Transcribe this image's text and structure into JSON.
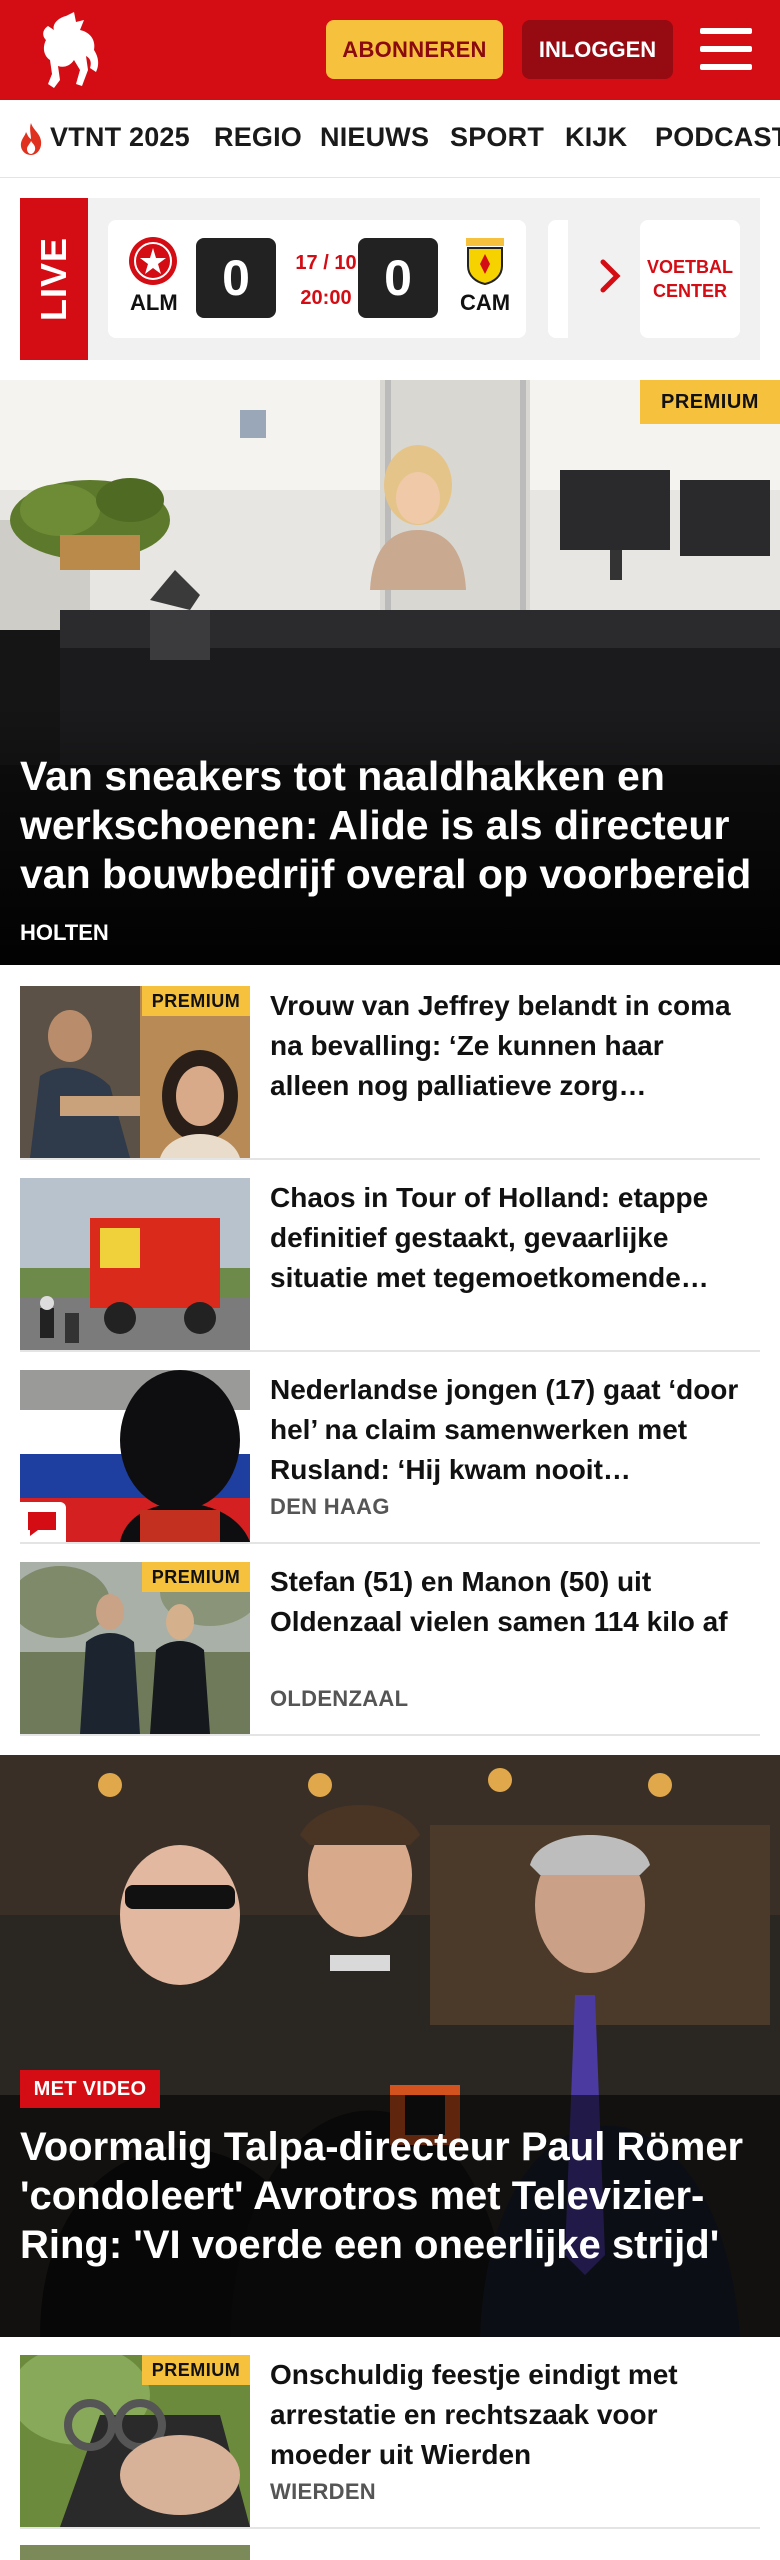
{
  "header": {
    "brand": "Tubantia",
    "subscribe_label": "ABONNEREN",
    "login_label": "INLOGGEN",
    "colors": {
      "brand_red": "#d40c14",
      "accent_yellow": "#f6c23d"
    }
  },
  "nav": {
    "items": [
      {
        "label": "VTNT 2025",
        "icon": "flame-icon"
      },
      {
        "label": "REGIO"
      },
      {
        "label": "NIEUWS"
      },
      {
        "label": "SPORT"
      },
      {
        "label": "KIJK"
      },
      {
        "label": "PODCAST"
      }
    ]
  },
  "live": {
    "badge": "LIVE",
    "match": {
      "home": "ALM",
      "away": "CAM",
      "home_score": "0",
      "away_score": "0",
      "date": "17 / 10",
      "time": "20:00"
    },
    "football_center": "VOETBAL CENTER"
  },
  "hero": {
    "premium": "PREMIUM",
    "title": "Van sneakers tot naaldhakken en werkschoenen: Alide is als directeur van bouwbedrijf overal op voorbereid",
    "location": "HOLTEN"
  },
  "articles": [
    {
      "premium": "PREMIUM",
      "title": "Vrouw van Jeffrey belandt in coma na bevalling: ‘Ze kunnen haar alleen nog palliatieve zorg…",
      "location": ""
    },
    {
      "premium": "",
      "title": "Chaos in Tour of Holland: etappe definitief gestaakt, gevaarlijke situatie met tegemoetkomende…",
      "location": ""
    },
    {
      "premium": "",
      "title": "Nederlandse jongen (17) gaat ‘door hel’ na claim samenwerken met Rusland: ‘Hij kwam nooit…",
      "location": "DEN HAAG",
      "has_comments": true
    },
    {
      "premium": "PREMIUM",
      "title": "Stefan (51) en Manon (50) uit Oldenzaal vielen samen 114 kilo af",
      "location": "OLDENZAAL"
    }
  ],
  "hero2": {
    "badge": "MET VIDEO",
    "title": "Voormalig Talpa-directeur Paul Römer 'condoleert' Avrotros met Televizier-Ring: 'VI voerde een oneerlijke strijd'"
  },
  "articles2": [
    {
      "premium": "PREMIUM",
      "title": "Onschuldig feestje eindigt met arrestatie en rechtszaak voor moeder uit Wierden",
      "location": "WIERDEN"
    }
  ]
}
